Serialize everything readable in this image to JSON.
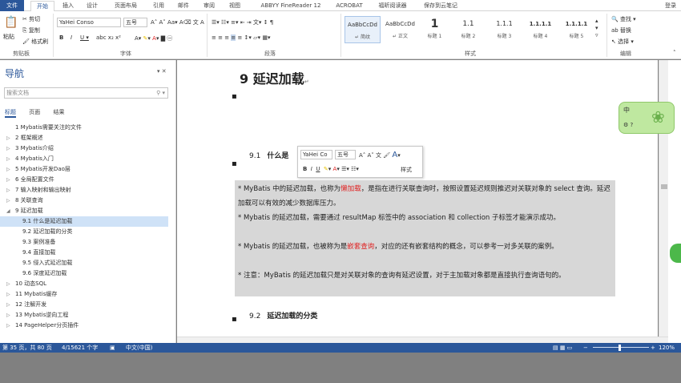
{
  "tabs": [
    "文件",
    "开始",
    "插入",
    "设计",
    "页面布局",
    "引用",
    "邮件",
    "审阅",
    "视图",
    "ABBYY FineReader 12",
    "ACROBAT",
    "福昕阅读器",
    "保存到云笔记"
  ],
  "user": "登录",
  "clipboard": {
    "paste": "粘贴",
    "cut": "剪切",
    "copy": "复制",
    "painter": "格式刷",
    "label": "剪贴板"
  },
  "font": {
    "name": "YaHei Conso",
    "size": "五号",
    "label": "字体"
  },
  "paragraph_label": "段落",
  "styles": {
    "label": "样式",
    "items": [
      {
        "preview": "AaBbCcDd",
        "name": "↵ 简纹"
      },
      {
        "preview": "AaBbCcDd",
        "name": "↵ 正文"
      },
      {
        "preview": "1",
        "name": "标题 1"
      },
      {
        "preview": "1.1",
        "name": "标题 2"
      },
      {
        "preview": "1.1.1",
        "name": "标题 3"
      },
      {
        "preview": "1.1.1.1",
        "name": "标题 4"
      },
      {
        "preview": "1.1.1.1",
        "name": "标题 5"
      }
    ]
  },
  "editing": {
    "find": "查找",
    "replace": "替换",
    "select": "选择",
    "label": "编辑"
  },
  "nav": {
    "title": "导航",
    "search_placeholder": "搜索文档",
    "tabs": [
      "标题",
      "页面",
      "结果"
    ],
    "items": [
      {
        "label": "1 Mybatis需要关注的文件",
        "level": 0,
        "arrow": ""
      },
      {
        "label": "2 框架概述",
        "level": 0,
        "arrow": "▷"
      },
      {
        "label": "3 Mybatis介绍",
        "level": 0,
        "arrow": "▷"
      },
      {
        "label": "4 Mybatis入门",
        "level": 0,
        "arrow": "▷"
      },
      {
        "label": "5 Mybatis开发Dao层",
        "level": 0,
        "arrow": "▷"
      },
      {
        "label": "6 全局配置文件",
        "level": 0,
        "arrow": "▷"
      },
      {
        "label": "7 输入映射和输出映射",
        "level": 0,
        "arrow": "▷"
      },
      {
        "label": "8 关联查询",
        "level": 0,
        "arrow": "▷"
      },
      {
        "label": "9 延迟加载",
        "level": 0,
        "arrow": "◢"
      },
      {
        "label": "9.1 什么是延迟加载",
        "level": 1,
        "arrow": "",
        "selected": true
      },
      {
        "label": "9.2 延迟加载的分类",
        "level": 1,
        "arrow": ""
      },
      {
        "label": "9.3 案例准备",
        "level": 1,
        "arrow": ""
      },
      {
        "label": "9.4 直接加载",
        "level": 1,
        "arrow": ""
      },
      {
        "label": "9.5 侵入式延迟加载",
        "level": 1,
        "arrow": ""
      },
      {
        "label": "9.6 深度延迟加载",
        "level": 1,
        "arrow": ""
      },
      {
        "label": "10 动态SQL",
        "level": 0,
        "arrow": "▷"
      },
      {
        "label": "11 Mybatis缓存",
        "level": 0,
        "arrow": "▷"
      },
      {
        "label": "12 注解开发",
        "level": 0,
        "arrow": "▷"
      },
      {
        "label": "13 Mybatis逆向工程",
        "level": 0,
        "arrow": "▷"
      },
      {
        "label": "14 PageHelper分页插件",
        "level": 0,
        "arrow": "▷"
      }
    ]
  },
  "doc": {
    "h1": "9 延迟加载",
    "h2a_num": "9.1",
    "h2a": "什么是",
    "h2b_num": "9.2",
    "h2b": "延迟加载的分类",
    "p1a": "* MyBatis 中的延迟加载，也称为",
    "p1red": "懒加载",
    "p1b": "，是指在进行关联查询时，按照设置延迟规则推迟对关联对象的 select 查询。延迟加载可以有效的减少数据库压力。",
    "p2": "* Mybatis 的延迟加载，需要通过 resultMap 标签中的 association 和 collection 子标签才能演示成功。",
    "p3a": "* Mybatis 的延迟加载，也被称为是",
    "p3red": "嵌套查询",
    "p3b": "，对应的还有嵌套结构的概念，可以参考一对多关联的案例。",
    "p4": "* 注意：MyBatis 的延迟加载只是对关联对象的查询有延迟设置，对于主加载对象都是直接执行查询语句的。"
  },
  "mini_toolbar": {
    "font": "YaHei Co",
    "size": "五号",
    "styles": "样式"
  },
  "status": {
    "page": "第 35 页，共 80 页",
    "words": "4/15621 个字",
    "lang": "中文(中国)",
    "zoom": "120%"
  },
  "widget_text": "中",
  "colors": {
    "accent": "#2b579a",
    "red": "#e02020",
    "highlight": "#d7d7d7"
  }
}
